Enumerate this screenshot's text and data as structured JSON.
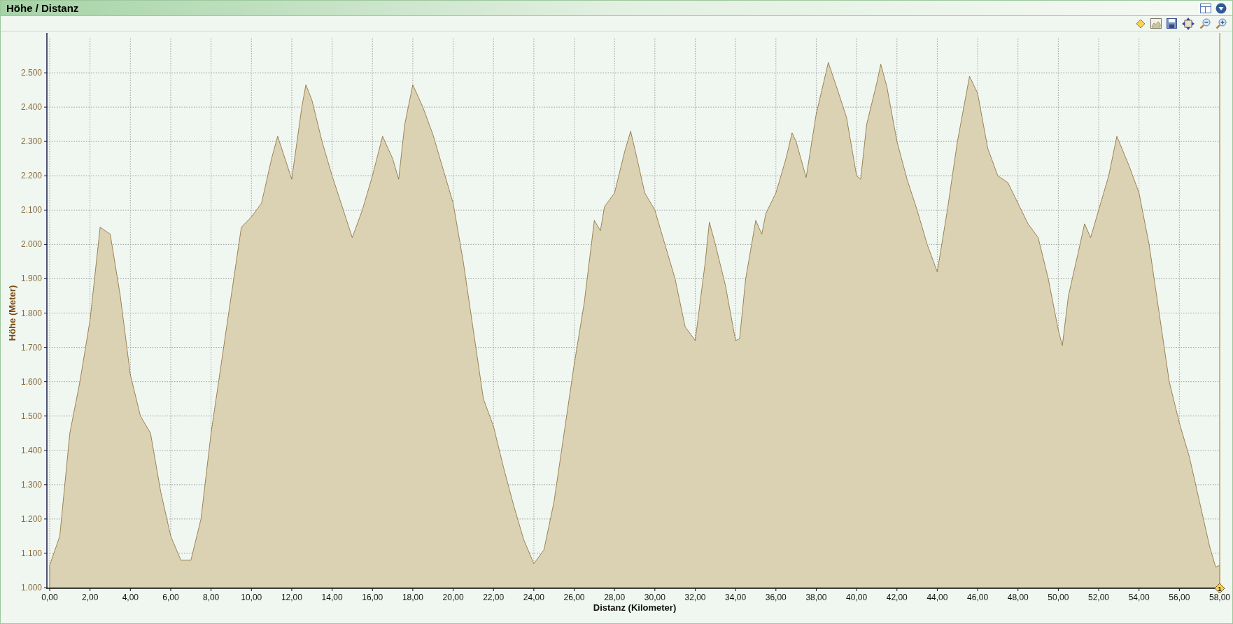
{
  "panel": {
    "title": "Höhe / Distanz"
  },
  "chart_data": {
    "type": "area",
    "xlabel": "Distanz (Kilometer)",
    "ylabel": "Höhe (Meter)",
    "xlim": [
      0,
      58
    ],
    "ylim": [
      1000,
      2600
    ],
    "x": [
      0,
      0.5,
      1,
      1.5,
      2,
      2.5,
      3,
      3.5,
      4,
      4.5,
      5,
      5.5,
      6,
      6.5,
      7,
      7.5,
      8,
      8.5,
      9,
      9.5,
      10,
      10.5,
      11,
      11.3,
      12,
      12.5,
      12.7,
      13,
      13.5,
      14,
      14.5,
      15,
      15.5,
      16,
      16.5,
      17,
      17.3,
      17.6,
      18,
      18.5,
      19,
      19.5,
      20,
      20.5,
      21,
      21.5,
      22,
      22.5,
      23,
      23.5,
      24,
      24.5,
      25,
      25.5,
      26,
      26.5,
      27,
      27.3,
      27.5,
      28,
      28.5,
      28.8,
      29,
      29.5,
      30,
      30.5,
      31,
      31.5,
      32,
      32.5,
      32.7,
      33,
      33.5,
      34,
      34.2,
      34.5,
      35,
      35.3,
      35.5,
      36,
      36.5,
      36.8,
      37,
      37.5,
      38,
      38.6,
      39,
      39.5,
      40,
      40.2,
      40.5,
      41,
      41.2,
      41.5,
      42,
      42.5,
      43,
      43.5,
      44,
      44.5,
      45,
      45.6,
      46,
      46.5,
      47,
      47.5,
      48,
      48.5,
      49,
      49.5,
      50,
      50.2,
      50.5,
      51,
      51.3,
      51.6,
      52,
      52.5,
      52.9,
      53.5,
      54,
      54.5,
      55,
      55.5,
      56,
      56.5,
      57,
      57.5,
      57.8,
      58
    ],
    "grid": true,
    "series": [
      {
        "color": "#7a5a1e",
        "values": [
          1065,
          1150,
          1450,
          1600,
          1780,
          2050,
          2030,
          1850,
          1620,
          1500,
          1450,
          1280,
          1150,
          1080,
          1080,
          1200,
          1450,
          1650,
          1850,
          2050,
          2080,
          2120,
          2250,
          2315,
          2190,
          2400,
          2465,
          2420,
          2300,
          2200,
          2110,
          2020,
          2100,
          2200,
          2315,
          2250,
          2190,
          2350,
          2465,
          2400,
          2320,
          2220,
          2120,
          1950,
          1750,
          1550,
          1470,
          1350,
          1240,
          1140,
          1070,
          1110,
          1250,
          1450,
          1650,
          1830,
          2070,
          2040,
          2110,
          2150,
          2270,
          2330,
          2280,
          2150,
          2100,
          2000,
          1900,
          1760,
          1720,
          1950,
          2065,
          2000,
          1880,
          1720,
          1725,
          1900,
          2070,
          2030,
          2090,
          2150,
          2250,
          2325,
          2300,
          2195,
          2380,
          2530,
          2460,
          2370,
          2200,
          2190,
          2350,
          2470,
          2525,
          2460,
          2300,
          2190,
          2100,
          2000,
          1920,
          2100,
          2300,
          2490,
          2440,
          2280,
          2200,
          2180,
          2120,
          2060,
          2020,
          1900,
          1750,
          1705,
          1850,
          1980,
          2060,
          2020,
          2100,
          2200,
          2315,
          2230,
          2150,
          2000,
          1800,
          1600,
          1480,
          1380,
          1250,
          1120,
          1060,
          1065
        ]
      }
    ],
    "xticks": [
      {
        "value": 0,
        "label": "0,00"
      },
      {
        "value": 2,
        "label": "2,00"
      },
      {
        "value": 4,
        "label": "4,00"
      },
      {
        "value": 6,
        "label": "6,00"
      },
      {
        "value": 8,
        "label": "8,00"
      },
      {
        "value": 10,
        "label": "10,00"
      },
      {
        "value": 12,
        "label": "12,00"
      },
      {
        "value": 14,
        "label": "14,00"
      },
      {
        "value": 16,
        "label": "16,00"
      },
      {
        "value": 18,
        "label": "18,00"
      },
      {
        "value": 20,
        "label": "20,00"
      },
      {
        "value": 22,
        "label": "22,00"
      },
      {
        "value": 24,
        "label": "24,00"
      },
      {
        "value": 26,
        "label": "26,00"
      },
      {
        "value": 28,
        "label": "28,00"
      },
      {
        "value": 30,
        "label": "30,00"
      },
      {
        "value": 32,
        "label": "32,00"
      },
      {
        "value": 34,
        "label": "34,00"
      },
      {
        "value": 36,
        "label": "36,00"
      },
      {
        "value": 38,
        "label": "38,00"
      },
      {
        "value": 40,
        "label": "40,00"
      },
      {
        "value": 42,
        "label": "42,00"
      },
      {
        "value": 44,
        "label": "44,00"
      },
      {
        "value": 46,
        "label": "46,00"
      },
      {
        "value": 48,
        "label": "48,00"
      },
      {
        "value": 50,
        "label": "50,00"
      },
      {
        "value": 52,
        "label": "52,00"
      },
      {
        "value": 54,
        "label": "54,00"
      },
      {
        "value": 56,
        "label": "56,00"
      },
      {
        "value": 58,
        "label": "58,00"
      }
    ],
    "yticks": [
      {
        "value": 1000,
        "label": "1.000"
      },
      {
        "value": 1100,
        "label": "1.100"
      },
      {
        "value": 1200,
        "label": "1.200"
      },
      {
        "value": 1300,
        "label": "1.300"
      },
      {
        "value": 1400,
        "label": "1.400"
      },
      {
        "value": 1500,
        "label": "1.500"
      },
      {
        "value": 1600,
        "label": "1.600"
      },
      {
        "value": 1700,
        "label": "1.700"
      },
      {
        "value": 1800,
        "label": "1.800"
      },
      {
        "value": 1900,
        "label": "1.900"
      },
      {
        "value": 2000,
        "label": "2.000"
      },
      {
        "value": 2100,
        "label": "2.100"
      },
      {
        "value": 2200,
        "label": "2.200"
      },
      {
        "value": 2300,
        "label": "2.300"
      },
      {
        "value": 2400,
        "label": "2.400"
      },
      {
        "value": 2500,
        "label": "2.500"
      }
    ]
  },
  "marker": {
    "label": "1"
  }
}
